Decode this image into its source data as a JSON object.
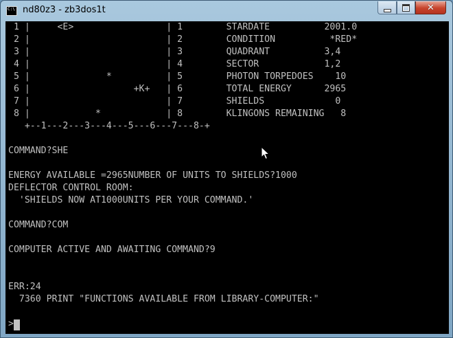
{
  "window": {
    "icon_text": "C:\\",
    "title": "nd80z3 - zb3dos1t",
    "controls": {
      "minimize_icon": "minimize-icon",
      "maximize_icon": "maximize-icon",
      "close_icon": "close-icon",
      "close_glyph": "✕"
    }
  },
  "console": {
    "lines": [
      " 1 |     <E>                 | 1        STARDATE          2001.0",
      " 2 |                         | 2        CONDITION          *RED*",
      " 3 |                         | 3        QUADRANT          3,4",
      " 4 |                         | 4        SECTOR            1,2",
      " 5 |              *          | 5        PHOTON TORPEDOES    10",
      " 6 |                   +K+   | 6        TOTAL ENERGY      2965",
      " 7 |                         | 7        SHIELDS             0",
      " 8 |            *            | 8        KLINGONS REMAINING   8",
      "   +--1---2---3---4---5---6---7---8-+",
      "",
      "COMMAND?SHE",
      "",
      "ENERGY AVAILABLE =2965NUMBER OF UNITS TO SHIELDS?1000",
      "DEFLECTOR CONTROL ROOM:",
      "  'SHIELDS NOW AT1000UNITS PER YOUR COMMAND.'",
      "",
      "COMMAND?COM",
      "",
      "COMPUTER ACTIVE AND AWAITING COMMAND?9",
      "",
      "",
      "ERR:24",
      "  7360 PRINT \"FUNCTIONS AVAILABLE FROM LIBRARY-COMPUTER:\"",
      "",
      ">"
    ]
  },
  "colors": {
    "console_background": "#000000",
    "console_text": "#c0c0c0",
    "close_button": "#c7432b"
  }
}
